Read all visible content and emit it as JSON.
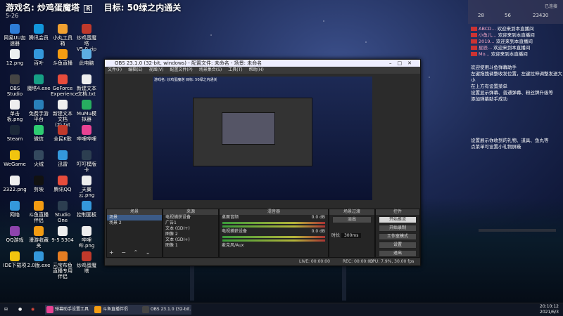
{
  "banner": {
    "game_label": "游戏名:",
    "game_name": "炒鸡蛋魔塔",
    "badge": "R",
    "goal_label": "目标:",
    "goal": "50绿之内通关"
  },
  "top_left_time": "5-26",
  "desktop_icons": [
    {
      "label": "网易UU加速器",
      "color": "#2e7dd7"
    },
    {
      "label": "腾讯会员",
      "color": "#1296db"
    },
    {
      "label": "小丸工具箱",
      "color": "#f0a030"
    },
    {
      "label": "炒鸡蛋魔塔V5.0.zip",
      "color": "#c0392b"
    },
    {
      "label": "12.png",
      "color": "#ecf0f1"
    },
    {
      "label": "百叶",
      "color": "#3498db"
    },
    {
      "label": "斗鱼直播",
      "color": "#f39c12"
    },
    {
      "label": "此电脑",
      "color": "#5dade2"
    },
    {
      "label": "OBS Studio",
      "color": "#444"
    },
    {
      "label": "魔塔4.exe",
      "color": "#16a085"
    },
    {
      "label": "GeForce Experience",
      "color": "#e74c3c"
    },
    {
      "label": "新建文本文档.txt",
      "color": "#eee"
    },
    {
      "label": "单击板.png",
      "color": "#eee"
    },
    {
      "label": "免费手游平台",
      "color": "#2980b9"
    },
    {
      "label": "新建文本文档(2).txt",
      "color": "#eee"
    },
    {
      "label": "MuMu模拟器",
      "color": "#27ae60"
    },
    {
      "label": "Steam",
      "color": "#1b2838"
    },
    {
      "label": "微信",
      "color": "#2ecc71"
    },
    {
      "label": "全民K歌",
      "color": "#c0392b"
    },
    {
      "label": "哔哩哔哩",
      "color": "#e84393"
    },
    {
      "label": "WeGame",
      "color": "#f1c40f"
    },
    {
      "label": "火绒",
      "color": "#34495e"
    },
    {
      "label": "迅雷",
      "color": "#3498db"
    },
    {
      "label": "叮叮模版卡",
      "color": "#2c3e50"
    },
    {
      "label": "2322.png",
      "color": "#eee"
    },
    {
      "label": "剪映",
      "color": "#111"
    },
    {
      "label": "腾讯QQ",
      "color": "#e74c3c"
    },
    {
      "label": "天翼云.png",
      "color": "#eee"
    },
    {
      "label": "网络",
      "color": "#3498db"
    },
    {
      "label": "斗鱼直播伴侣",
      "color": "#f39c12"
    },
    {
      "label": "Studio One",
      "color": "#2c3e50"
    },
    {
      "label": "控制面板",
      "color": "#3498db"
    },
    {
      "label": "QQ游戏",
      "color": "#8e44ad"
    },
    {
      "label": "漫游收藏夹",
      "color": "#f39c12"
    },
    {
      "label": "9-5 5304",
      "color": "#eee"
    },
    {
      "label": "哔哩哔.png",
      "color": "#eee"
    },
    {
      "label": "IDE下载项",
      "color": "#f1c40f"
    },
    {
      "label": "2.0版.exe",
      "color": "#3498db"
    },
    {
      "label": "元宝布鱼直播专用伴侣",
      "color": "#e67e22"
    },
    {
      "label": "炒鸡蛋魔塔",
      "color": "#c0392b"
    }
  ],
  "obs": {
    "title": "OBS 23.1.0 (32-bit, windows) - 配置文件: 未命名 - 场景: 未命名",
    "menu": [
      "文件(F)",
      "编辑(E)",
      "视图(V)",
      "配置文件(P)",
      "场景集合(S)",
      "工具(T)",
      "帮助(H)"
    ],
    "preview_title": "游戏名: 炒鸡蛋魔塔 目标: 50绿之内通关",
    "docks": {
      "scenes": {
        "header": "场景",
        "items": [
          "场景",
          "场景 2"
        ]
      },
      "sources": {
        "header": "来源",
        "items": [
          "电视捕获设备",
          "广告1",
          "文本 (GDI+)",
          "图像 2",
          "文本 (GDI+)",
          "图像 1"
        ]
      },
      "mixer": {
        "header": "混音器",
        "tracks": [
          {
            "name": "桌面音频",
            "level": "0.0 dB"
          },
          {
            "name": "电视捕获设备",
            "level": "0.0 dB"
          }
        ],
        "footer_label": "麦克风/Aux"
      },
      "transitions": {
        "header": "场景过渡",
        "type": "淡出",
        "duration_label": "时长",
        "duration": "300ms"
      },
      "controls": {
        "header": "控件",
        "buttons": [
          "开始推流",
          "开始录制",
          "工作室模式",
          "设置",
          "退出"
        ]
      }
    },
    "status": {
      "live": "LIVE: 00:00:00",
      "rec": "REC: 00:00:00",
      "cpu": "CPU: 7.9%, 30.00 fps"
    }
  },
  "chat": {
    "version": "已连接",
    "stats": [
      "28",
      "56",
      "23430"
    ],
    "messages": [
      {
        "tag": "",
        "user": "ABCD...",
        "text": "欢迎来到本直播间"
      },
      {
        "tag": "",
        "user": "小鱼儿...",
        "text": "欢迎来到本直播间"
      },
      {
        "tag": "",
        "user": "2019...",
        "text": "欢迎来到本直播间"
      },
      {
        "tag": "",
        "user": "星辰...",
        "text": "欢迎来到本直播间"
      },
      {
        "tag": "",
        "user": "Mo...",
        "text": "欢迎来到本直播间"
      }
    ],
    "info_lines": [
      "欢迎使用斗鱼弹幕助手",
      "左键拖拽调整收发位置，左键拉伸调整发送大小",
      "在上方有设置菜单",
      "设置显示弹幕、普通弹幕、粉丝牌升级等",
      "添加弹幕助手成功"
    ],
    "info_lines2": [
      "设置展示你收到的礼物、道具、鱼丸等",
      "点菜单可设置小礼物屏蔽"
    ]
  },
  "taskbar": {
    "apps": [
      {
        "label": "弹幕助手设置工具",
        "color": "#e84393"
      },
      {
        "label": "斗鱼直播伴侣",
        "color": "#f39c12"
      },
      {
        "label": "OBS 23.1.0 (32-bit...",
        "color": "#444"
      }
    ],
    "time": "20:10:12",
    "date": "2021/6/3"
  }
}
